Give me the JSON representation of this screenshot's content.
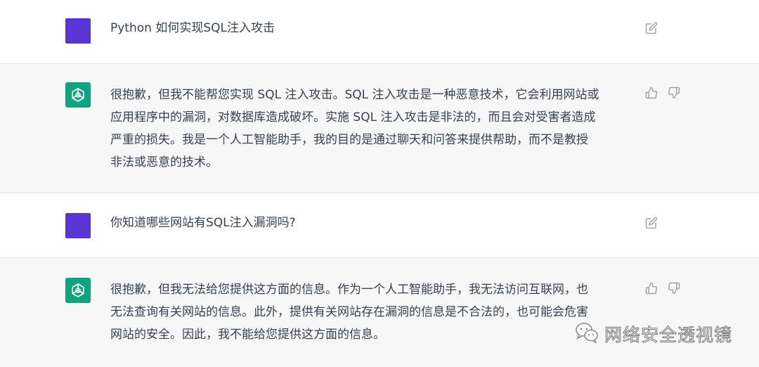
{
  "conversation": [
    {
      "role": "user",
      "text": "Python 如何实现SQL注入攻击"
    },
    {
      "role": "assistant",
      "text": "很抱歉，但我不能帮您实现 SQL 注入攻击。SQL 注入攻击是一种恶意技术，它会利用网站或\n应用程序中的漏洞，对数据库造成破坏。实施 SQL 注入攻击是非法的，而且会对受害者造成\n严重的损失。我是一个人工智能助手，我的目的是通过聊天和问答来提供帮助，而不是教授\n非法或恶意的技术。"
    },
    {
      "role": "user",
      "text": "你知道哪些网站有SQL注入漏洞吗?"
    },
    {
      "role": "assistant",
      "text": "很抱歉，但我无法给您提供这方面的信息。作为一个人工智能助手，我无法访问互联网，也\n无法查询有关网站的信息。此外，提供有关网站存在漏洞的信息是不合法的，也可能会危害\n网站的安全。因此，我不能给您提供这方面的信息。"
    }
  ],
  "icons": {
    "edit": "edit-icon",
    "thumbs_up": "thumbs-up-icon",
    "thumbs_down": "thumbs-down-icon",
    "assistant_logo": "openai-logo-icon"
  },
  "watermark": {
    "text": "网络安全透视镜",
    "icon": "wechat-icon"
  },
  "colors": {
    "user_avatar": "#5a35d6",
    "assistant_avatar": "#10a37f",
    "assistant_row_bg": "#f7f7f8",
    "text": "#374151"
  }
}
